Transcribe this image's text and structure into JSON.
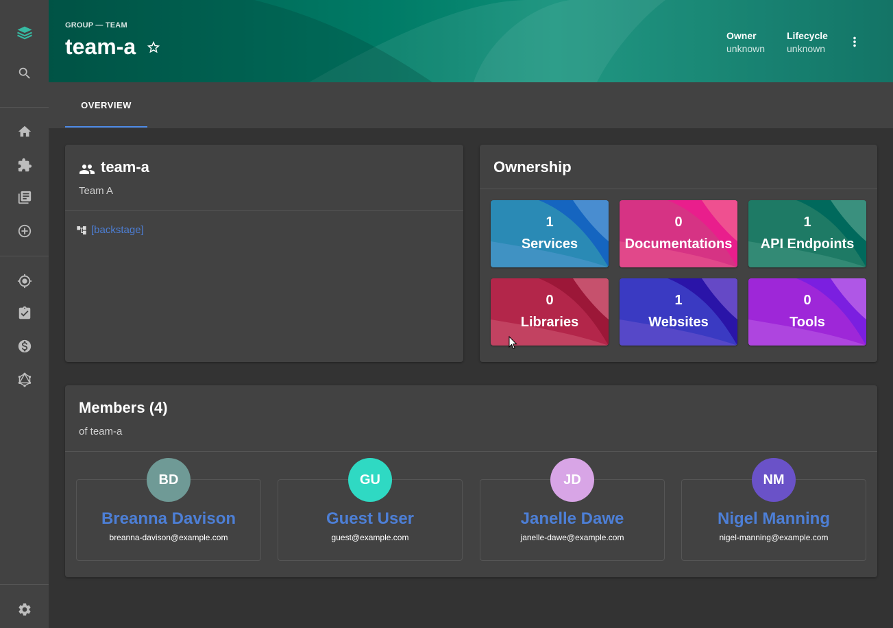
{
  "sidebar": {
    "items": [
      {
        "name": "logo",
        "icon": "backstage-logo-icon"
      },
      {
        "name": "search",
        "icon": "search-icon"
      },
      {
        "name": "home",
        "icon": "home-icon"
      },
      {
        "name": "apis",
        "icon": "puzzle-icon"
      },
      {
        "name": "docs",
        "icon": "library-icon"
      },
      {
        "name": "create",
        "icon": "add-circle-icon"
      },
      {
        "name": "tech-radar",
        "icon": "radar-icon"
      },
      {
        "name": "tasks",
        "icon": "assignment-icon"
      },
      {
        "name": "cost",
        "icon": "money-icon"
      },
      {
        "name": "graphiql",
        "icon": "graphql-icon"
      },
      {
        "name": "settings",
        "icon": "gear-icon"
      }
    ]
  },
  "header": {
    "kind": "GROUP — TEAM",
    "title": "team-a",
    "owner_label": "Owner",
    "owner_value": "unknown",
    "lifecycle_label": "Lifecycle",
    "lifecycle_value": "unknown"
  },
  "tabs": [
    {
      "label": "OVERVIEW",
      "active": true
    }
  ],
  "profile_card": {
    "title": "team-a",
    "subtitle": "Team A",
    "parent_link": "[backstage]"
  },
  "ownership": {
    "title": "Ownership",
    "tiles": [
      {
        "count": "1",
        "kind": "Services",
        "colors": [
          "#2a8ab5",
          "#1565c0",
          "#5b9bd5"
        ]
      },
      {
        "count": "0",
        "kind": "Documentations",
        "colors": [
          "#d63384",
          "#e91e8c",
          "#f06292"
        ]
      },
      {
        "count": "1",
        "kind": "API Endpoints",
        "colors": [
          "#1e7a65",
          "#00695c",
          "#4e9e8a"
        ]
      },
      {
        "count": "0",
        "kind": "Libraries",
        "colors": [
          "#b3264a",
          "#9c1738",
          "#d4657f"
        ]
      },
      {
        "count": "1",
        "kind": "Websites",
        "colors": [
          "#3a3ac2",
          "#2a14a8",
          "#7a5bd0"
        ]
      },
      {
        "count": "0",
        "kind": "Tools",
        "colors": [
          "#9e27d8",
          "#7b1fe0",
          "#c06be8"
        ]
      }
    ]
  },
  "members": {
    "title": "Members (4)",
    "subtitle": "of team-a",
    "list": [
      {
        "initials": "BD",
        "name": "Breanna Davison",
        "email": "breanna-davison@example.com",
        "color": "#6f9a96"
      },
      {
        "initials": "GU",
        "name": "Guest User",
        "email": "guest@example.com",
        "color": "#2fd9c3"
      },
      {
        "initials": "JD",
        "name": "Janelle Dawe",
        "email": "janelle-dawe@example.com",
        "color": "#d8a5e6"
      },
      {
        "initials": "NM",
        "name": "Nigel Manning",
        "email": "nigel-manning@example.com",
        "color": "#6a52c8"
      }
    ]
  }
}
